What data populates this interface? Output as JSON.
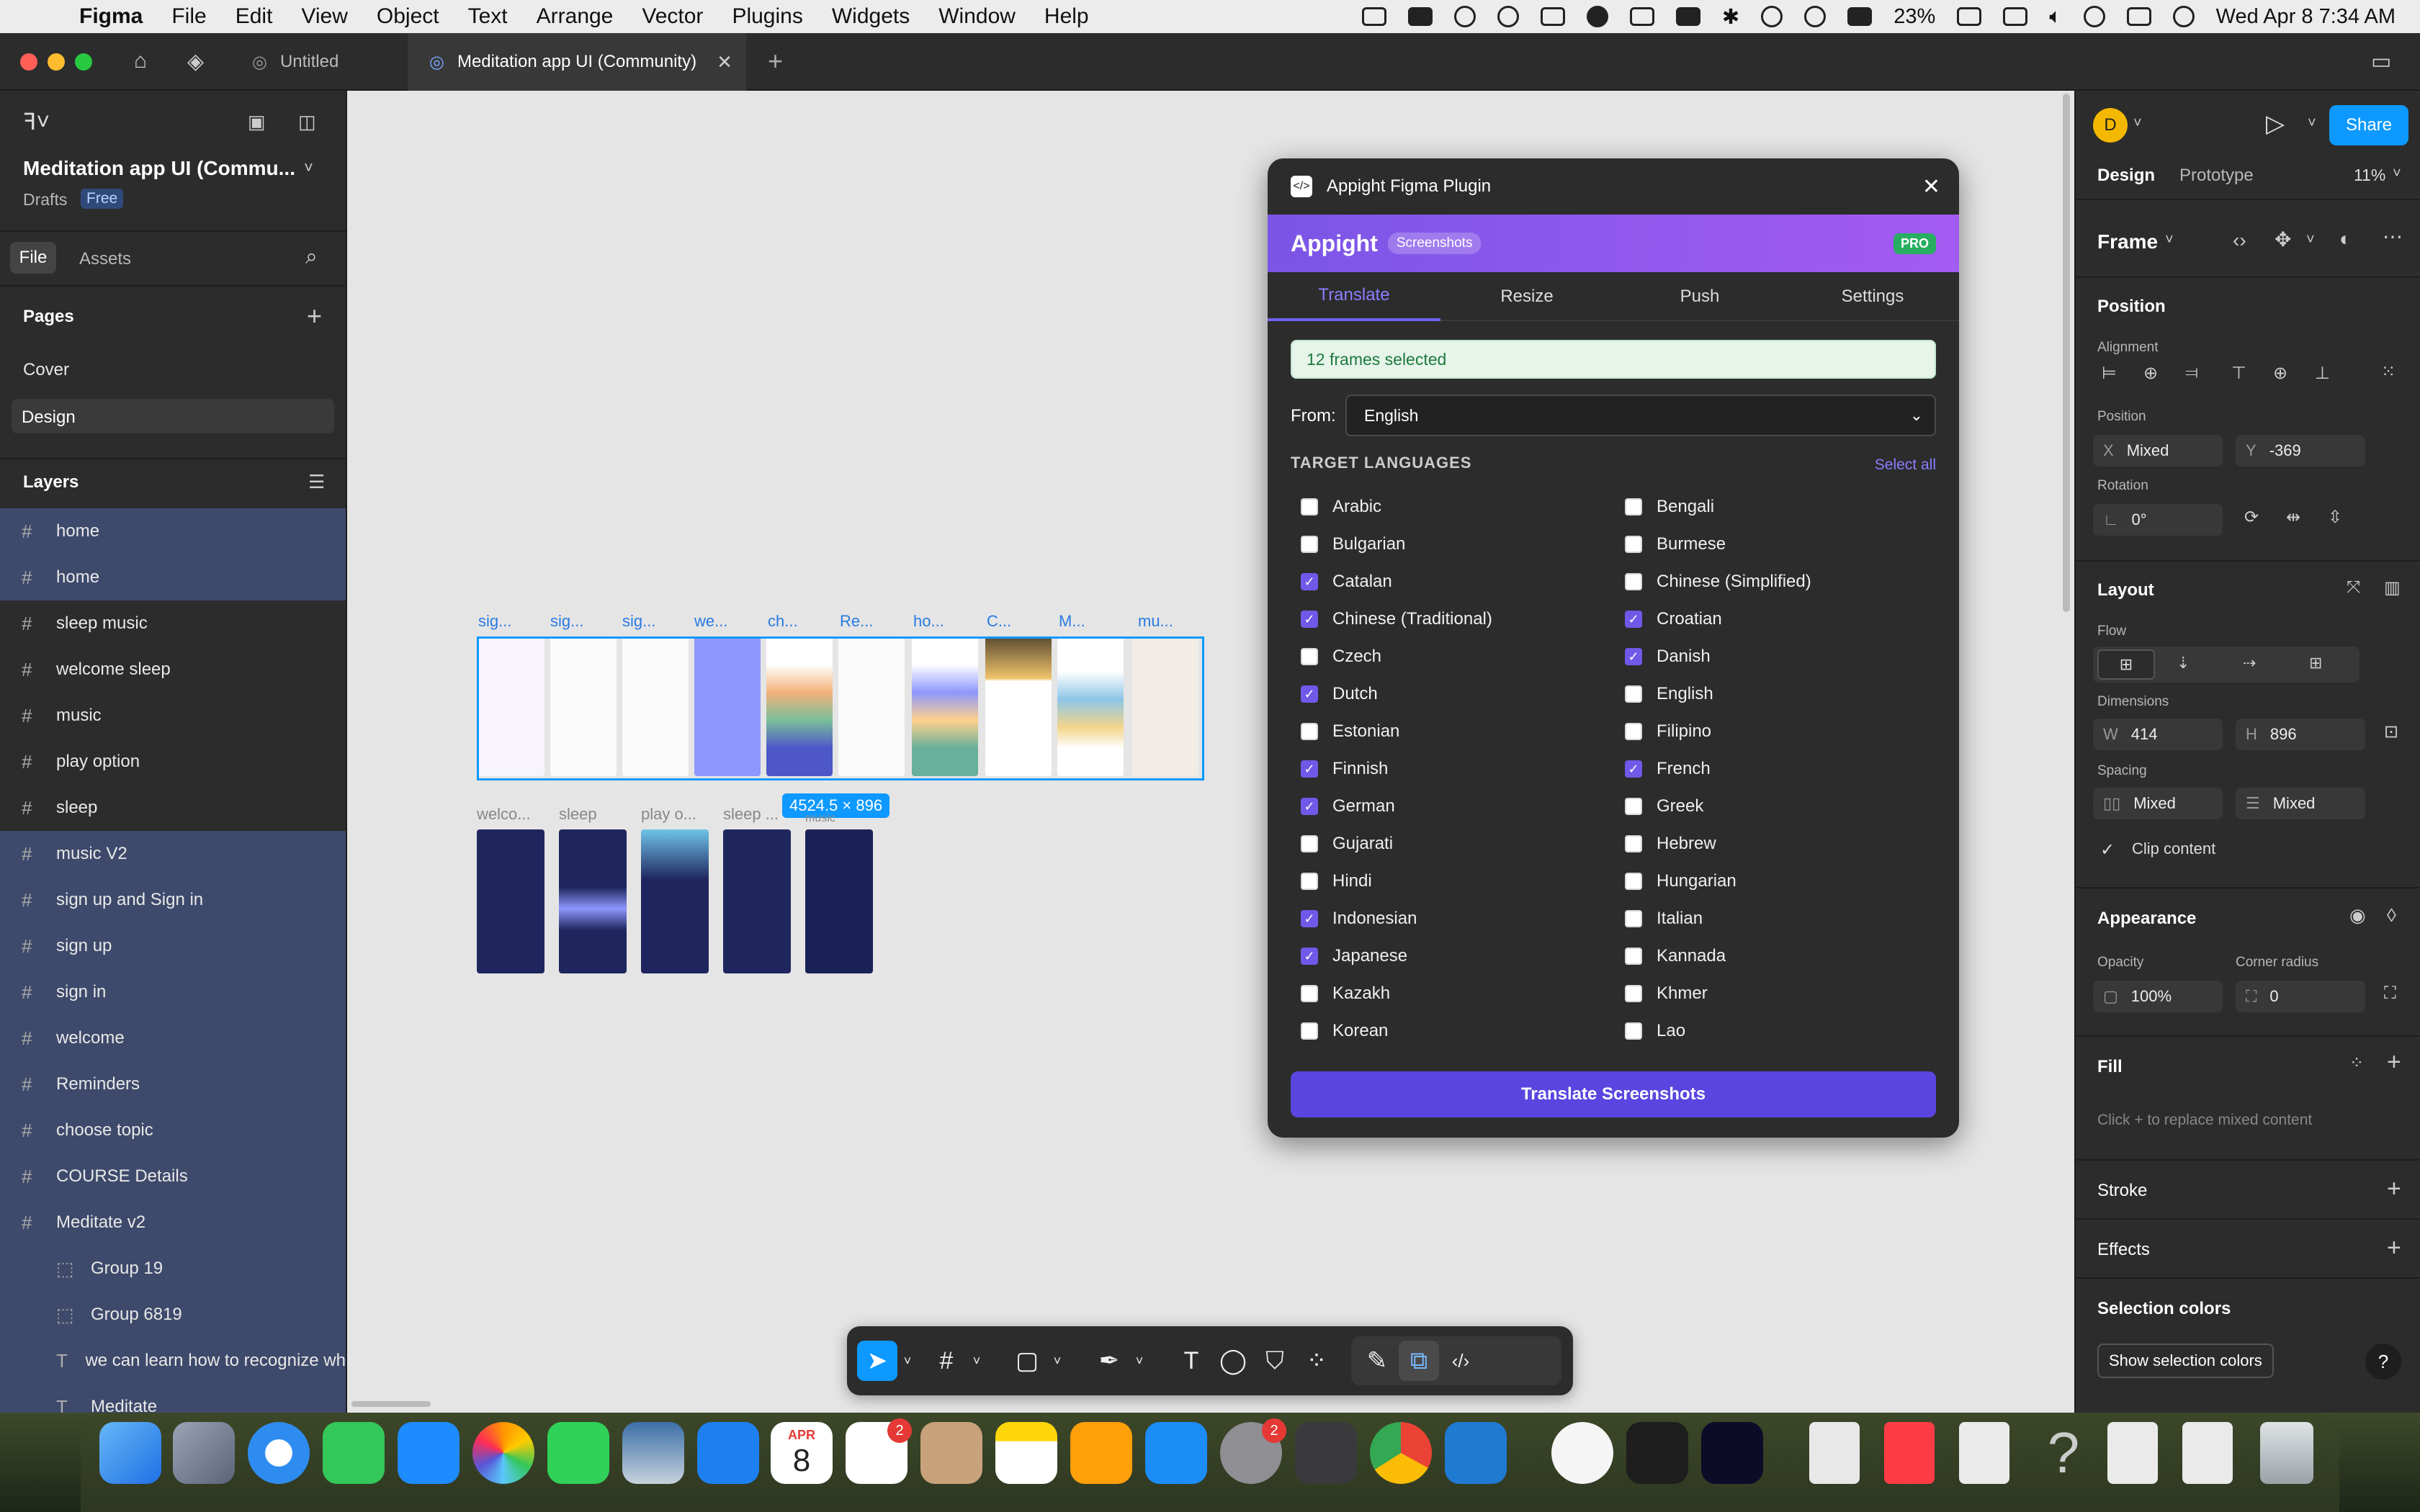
{
  "menubar": {
    "app": "Figma",
    "menus": [
      "File",
      "Edit",
      "View",
      "Object",
      "Text",
      "Arrange",
      "Vector",
      "Plugins",
      "Widgets",
      "Window",
      "Help"
    ],
    "battery": "23%",
    "datetime": "Wed Apr 8  7:34 AM"
  },
  "tabs": {
    "untitled": "Untitled",
    "active": "Meditation app UI (Community)"
  },
  "left_panel": {
    "file_title": "Meditation app UI (Commu...",
    "drafts": "Drafts",
    "plan_badge": "Free",
    "tab_file": "File",
    "tab_assets": "Assets",
    "pages_heading": "Pages",
    "pages": [
      "Cover",
      "Design"
    ],
    "layers_heading": "Layers",
    "layers": [
      {
        "label": "home",
        "icon": "#"
      },
      {
        "label": "home",
        "icon": "#"
      },
      {
        "label": "sleep music",
        "icon": "#"
      },
      {
        "label": "welcome sleep",
        "icon": "#"
      },
      {
        "label": "music",
        "icon": "#"
      },
      {
        "label": "play option",
        "icon": "#"
      },
      {
        "label": "sleep",
        "icon": "#"
      },
      {
        "label": "music V2",
        "icon": "#"
      },
      {
        "label": "sign up and Sign in",
        "icon": "#"
      },
      {
        "label": "sign up",
        "icon": "#"
      },
      {
        "label": "sign in",
        "icon": "#"
      },
      {
        "label": "welcome",
        "icon": "#"
      },
      {
        "label": "Reminders",
        "icon": "#"
      },
      {
        "label": "choose topic",
        "icon": "#"
      },
      {
        "label": "COURSE Details",
        "icon": "#"
      },
      {
        "label": "Meditate v2",
        "icon": "#"
      },
      {
        "label": "Group 19",
        "icon": "⬚"
      },
      {
        "label": "Group 6819",
        "icon": "⬚"
      },
      {
        "label": "we can learn how to recognize wh",
        "icon": "T"
      },
      {
        "label": "Meditate",
        "icon": "T"
      }
    ]
  },
  "canvas": {
    "top_frame_labels": [
      "sig...",
      "sig...",
      "sig...",
      "we...",
      "ch...",
      "Re...",
      "ho...",
      "C...",
      "M...",
      "mu..."
    ],
    "bottom_frame_labels": [
      "welco...",
      "sleep",
      "play o...",
      "sleep ...",
      "music"
    ],
    "selection_size": "4524.5 × 896"
  },
  "plugin": {
    "title": "Appight Figma Plugin",
    "brand": "Appight",
    "brand_tag": "Screenshots",
    "pro_badge": "PRO",
    "tabs": [
      "Translate",
      "Resize",
      "Push",
      "Settings"
    ],
    "status": "12 frames selected",
    "from_label": "From:",
    "from_value": "English",
    "target_heading": "TARGET LANGUAGES",
    "select_all": "Select all",
    "languages_left": [
      {
        "name": "Arabic",
        "checked": false
      },
      {
        "name": "Bulgarian",
        "checked": false
      },
      {
        "name": "Catalan",
        "checked": true
      },
      {
        "name": "Chinese (Traditional)",
        "checked": true
      },
      {
        "name": "Czech",
        "checked": false
      },
      {
        "name": "Dutch",
        "checked": true
      },
      {
        "name": "Estonian",
        "checked": false
      },
      {
        "name": "Finnish",
        "checked": true
      },
      {
        "name": "German",
        "checked": true
      },
      {
        "name": "Gujarati",
        "checked": false
      },
      {
        "name": "Hindi",
        "checked": false
      },
      {
        "name": "Indonesian",
        "checked": true
      },
      {
        "name": "Japanese",
        "checked": true
      },
      {
        "name": "Kazakh",
        "checked": false
      },
      {
        "name": "Korean",
        "checked": false
      }
    ],
    "languages_right": [
      {
        "name": "Bengali",
        "checked": false
      },
      {
        "name": "Burmese",
        "checked": false
      },
      {
        "name": "Chinese (Simplified)",
        "checked": false
      },
      {
        "name": "Croatian",
        "checked": true
      },
      {
        "name": "Danish",
        "checked": true
      },
      {
        "name": "English",
        "checked": false
      },
      {
        "name": "Filipino",
        "checked": false
      },
      {
        "name": "French",
        "checked": true
      },
      {
        "name": "Greek",
        "checked": false
      },
      {
        "name": "Hebrew",
        "checked": false
      },
      {
        "name": "Hungarian",
        "checked": false
      },
      {
        "name": "Italian",
        "checked": false
      },
      {
        "name": "Kannada",
        "checked": false
      },
      {
        "name": "Khmer",
        "checked": false
      },
      {
        "name": "Lao",
        "checked": false
      }
    ],
    "action_button": "Translate Screenshots"
  },
  "right_panel": {
    "avatar_letter": "D",
    "share": "Share",
    "tab_design": "Design",
    "tab_prototype": "Prototype",
    "zoom": "11%",
    "frame_label": "Frame",
    "position_heading": "Position",
    "alignment_label": "Alignment",
    "position_label": "Position",
    "x_key": "X",
    "x_value": "Mixed",
    "y_key": "Y",
    "y_value": "-369",
    "rotation_label": "Rotation",
    "rotation_value": "0°",
    "layout_heading": "Layout",
    "flow_label": "Flow",
    "dimensions_label": "Dimensions",
    "w_key": "W",
    "w_value": "414",
    "h_key": "H",
    "h_value": "896",
    "spacing_label": "Spacing",
    "spacing_h": "Mixed",
    "spacing_v": "Mixed",
    "clip_content": "Clip content",
    "appearance_heading": "Appearance",
    "opacity_label": "Opacity",
    "opacity_value": "100%",
    "corner_label": "Corner radius",
    "corner_value": "0",
    "fill_heading": "Fill",
    "fill_hint": "Click + to replace mixed content",
    "stroke_heading": "Stroke",
    "effects_heading": "Effects",
    "selection_colors_heading": "Selection colors",
    "show_selection_colors": "Show selection colors"
  },
  "dock": {
    "calendar_month": "APR",
    "calendar_day": "8",
    "reminders_badge": "2",
    "settings_badge": "2"
  }
}
